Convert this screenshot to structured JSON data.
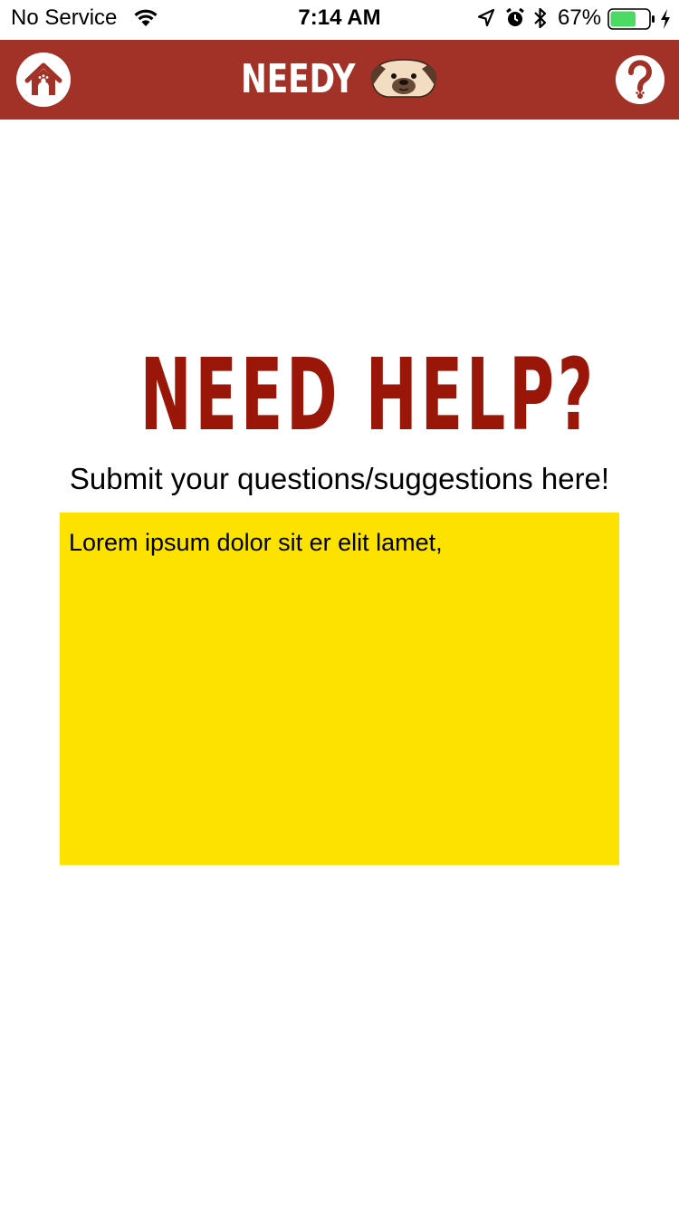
{
  "status_bar": {
    "carrier": "No Service",
    "time": "7:14 AM",
    "battery_percent": "67%",
    "battery_level": 0.67,
    "battery_color": "#4cd964",
    "icons": [
      "wifi-icon",
      "location-arrow-icon",
      "alarm-icon",
      "bluetooth-icon",
      "battery-icon",
      "charging-bolt-icon"
    ]
  },
  "nav": {
    "background": "#a23127",
    "title": "NEEDY",
    "left_icon": "doghouse-home-icon",
    "right_icon": "question-paw-help-icon",
    "logo_icon": "pug-face-icon"
  },
  "main": {
    "heading": "NEED HELP?",
    "heading_color": "#9a1608",
    "subtitle": "Submit your questions/suggestions here!",
    "message_value": "Lorem ipsum dolor sit er elit lamet,",
    "message_box_color": "#fde200"
  }
}
